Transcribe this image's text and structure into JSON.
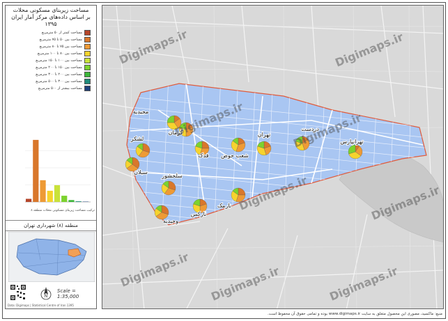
{
  "panel": {
    "title_line1": "مساحت زیربنای مسکونی محلات",
    "title_line2": "بر اساس داده‌های مرکز آمار ایران ۱۳۹۵"
  },
  "legend": {
    "items": [
      {
        "label": "مساحت کمتر از ۵۰ مترمربع",
        "color": "#b5462b"
      },
      {
        "label": "مساحت بین ۵۰ تا ۷۵ مترمربع",
        "color": "#d9772b"
      },
      {
        "label": "مساحت بین ۷۵ تا ۸۰ مترمربع",
        "color": "#ee9a35"
      },
      {
        "label": "مساحت بین ۸۰ تا ۱۰۰ مترمربع",
        "color": "#f6d32e"
      },
      {
        "label": "مساحت بین ۱۰۰ تا ۱۵۰ مترمربع",
        "color": "#c9e23a"
      },
      {
        "label": "مساحت بین ۱۵۰ تا ۲۰۰ مترمربع",
        "color": "#7cd22e"
      },
      {
        "label": "مساحت بین ۲۰۰ تا ۳۰۰ مترمربع",
        "color": "#3cb63a"
      },
      {
        "label": "مساحت بین ۳۰۰ تا ۵۰۰ مترمربع",
        "color": "#1f8a7a"
      },
      {
        "label": "مساحت بیشتر از ۵۰۰ مترمربع",
        "color": "#1d3f7a"
      }
    ]
  },
  "chart_data": {
    "type": "bar",
    "categories": [
      "<50",
      "50-75",
      "75-80",
      "80-100",
      "100-150",
      "150-200",
      "200-300",
      "300-500",
      ">500"
    ],
    "values": [
      5,
      100,
      35,
      18,
      27,
      10,
      3,
      1,
      0.5
    ],
    "ylim": [
      0,
      110
    ],
    "colors": [
      "#b5462b",
      "#d9772b",
      "#ee9a35",
      "#f6d32e",
      "#c9e23a",
      "#7cd22e",
      "#3cb63a",
      "#1f8a7a",
      "#1d3f7a"
    ],
    "caption": "ترکیب مساحت زیربنای مسکونی محلات منطقه ۸"
  },
  "inset": {
    "title": "منطقه (۸) شهرداری تهران"
  },
  "scale": {
    "text": "Scale = 1:35,000"
  },
  "north_label": "N",
  "credits": "Data: Digimaps | Statistical Centre of Iran 1395",
  "footer": "منبع: ماکسید، مصوری این محصول متعلق به سایت www.digimaps.ir بوده و تمامی حقوق آن محفوظ است.",
  "watermark": "Digimaps.ir",
  "neighborhoods": [
    {
      "name": "مجیدیه",
      "pie": [
        0.15,
        0.25,
        0.35,
        0.25
      ]
    },
    {
      "name": "گرمان",
      "pie": [
        0.2,
        0.3,
        0.3,
        0.2
      ]
    },
    {
      "name": "لشکر",
      "pie": [
        0.3,
        0.3,
        0.25,
        0.15
      ]
    },
    {
      "name": "سبلان",
      "pie": [
        0.35,
        0.3,
        0.2,
        0.15
      ]
    },
    {
      "name": "قدک",
      "pie": [
        0.25,
        0.3,
        0.25,
        0.2
      ]
    },
    {
      "name": "شعب حوض",
      "pie": [
        0.2,
        0.35,
        0.3,
        0.15
      ]
    },
    {
      "name": "تهران",
      "pie": [
        0.2,
        0.25,
        0.35,
        0.2
      ]
    },
    {
      "name": "دردست",
      "pie": [
        0.15,
        0.3,
        0.35,
        0.2
      ]
    },
    {
      "name": "تهرانپارس",
      "pie": [
        0.1,
        0.25,
        0.35,
        0.3
      ]
    },
    {
      "name": "سلحشور",
      "pie": [
        0.3,
        0.3,
        0.25,
        0.15
      ]
    },
    {
      "name": "نارمک",
      "pie": [
        0.25,
        0.3,
        0.3,
        0.15
      ]
    },
    {
      "name": "وحیدیه",
      "pie": [
        0.3,
        0.35,
        0.2,
        0.15
      ]
    },
    {
      "name": "نارکس",
      "pie": [
        0.2,
        0.3,
        0.3,
        0.2
      ]
    }
  ]
}
